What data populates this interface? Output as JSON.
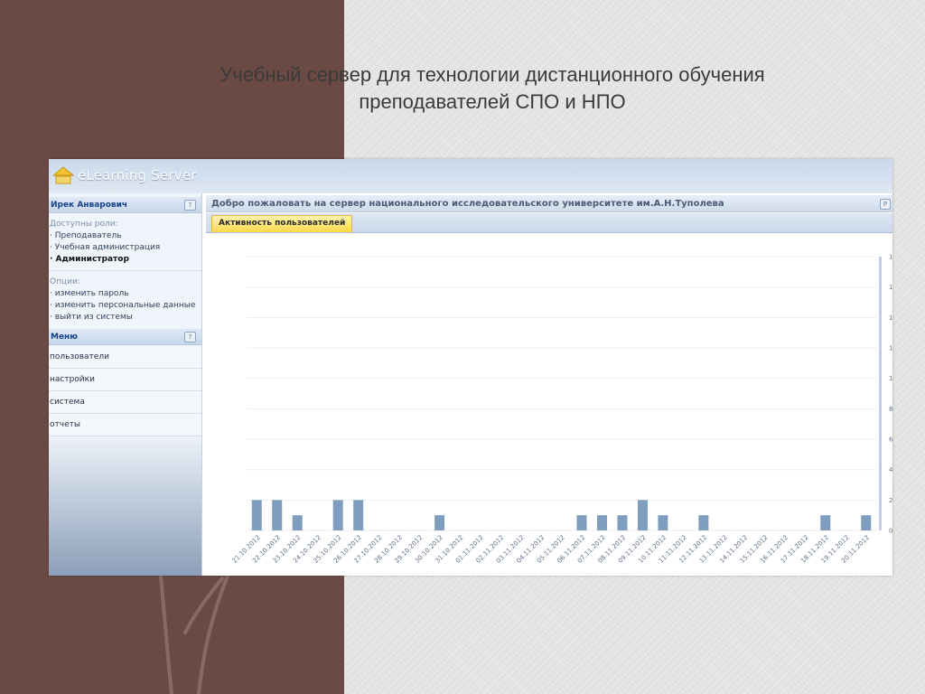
{
  "slide": {
    "title_line1": "Учебный сервер для технологии дистанционного обучения",
    "title_line2": "преподавателей СПО и НПО"
  },
  "app": {
    "logo_icon": "house-icon",
    "logo_text": "eLearning Server"
  },
  "sidebar": {
    "user_name": "Ирек Анварович",
    "help_icon": "?",
    "roles_label": "Доступны роли:",
    "roles": [
      {
        "label": "· Преподаватель"
      },
      {
        "label": "· Учебная администрация"
      },
      {
        "label": "· Администратор"
      }
    ],
    "options_label": "Опции:",
    "options": [
      {
        "label": "· изменить пароль"
      },
      {
        "label": "· изменить персональные данные"
      },
      {
        "label": "· выйти из системы"
      }
    ],
    "menu_title": "Меню",
    "menu_items": [
      {
        "label": "пользователи"
      },
      {
        "label": "настройки"
      },
      {
        "label": "система"
      },
      {
        "label": "отчеты"
      }
    ]
  },
  "main": {
    "header": "Добро пожаловать на сервер национального исследовательского университете им.А.Н.Туполева",
    "header_btn": "P",
    "tab_active": "Активность пользователей"
  },
  "colors": {
    "bar": "#7f9dbf",
    "tab_active": "#ffd94a",
    "header_text": "#15428b"
  },
  "chart_data": {
    "type": "bar",
    "categories": [
      "21.10.2012",
      "22.10.2012",
      "23.10.2012",
      "24.10.2012",
      "25.10.2012",
      "26.10.2012",
      "27.10.2012",
      "28.10.2012",
      "29.10.2012",
      "30.10.2012",
      "31.10.2012",
      "01.11.2012",
      "02.11.2012",
      "03.11.2012",
      "04.11.2012",
      "05.11.2012",
      "06.11.2012",
      "07.11.2012",
      "08.11.2012",
      "09.11.2012",
      "10.11.2012",
      "11.11.2012",
      "12.11.2012",
      "13.11.2012",
      "14.11.2012",
      "15.11.2012",
      "16.11.2012",
      "17.11.2012",
      "18.11.2012",
      "19.11.2012",
      "20.11.2012"
    ],
    "values": [
      2,
      2,
      1,
      0,
      2,
      2,
      0,
      0,
      0,
      1,
      0,
      0,
      0,
      0,
      0,
      0,
      1,
      1,
      1,
      2,
      1,
      0,
      1,
      0,
      0,
      0,
      0,
      0,
      1,
      0,
      1
    ],
    "yticks": [
      "0",
      "2",
      "4",
      "6",
      "8",
      "1",
      "1",
      "1",
      "1",
      "1"
    ],
    "ylim": [
      0,
      18
    ],
    "grid": true
  }
}
